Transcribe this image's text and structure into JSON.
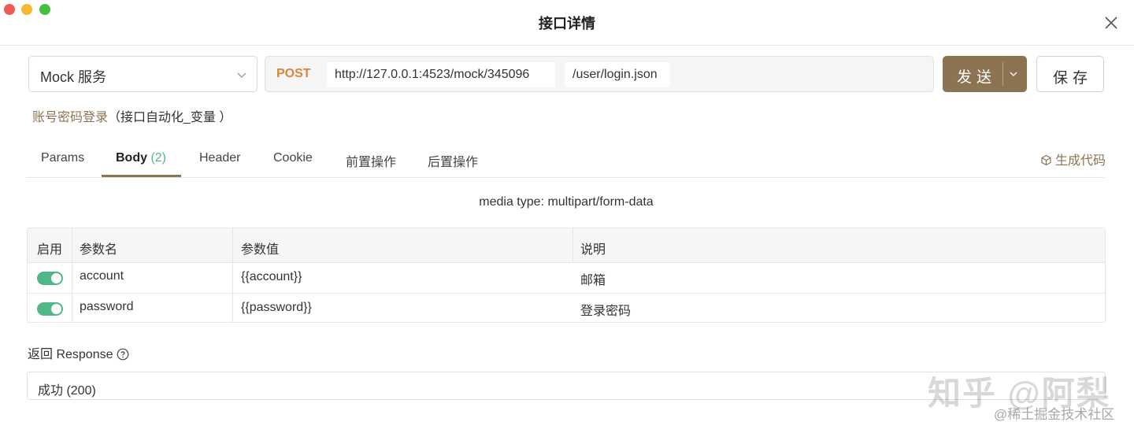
{
  "window": {
    "title": "接口详情"
  },
  "env": {
    "value": "Mock 服务"
  },
  "request": {
    "method": "POST",
    "base_url": "http://127.0.0.1:4523/mock/345096",
    "path": "/user/login.json"
  },
  "actions": {
    "send_label": "发送",
    "save_label": "保存"
  },
  "api": {
    "name": "账号密码登录",
    "group": "（接口自动化_变量 ）"
  },
  "tabs": [
    {
      "label": "Params"
    },
    {
      "label": "Body",
      "count": "(2)"
    },
    {
      "label": "Header"
    },
    {
      "label": "Cookie"
    },
    {
      "label": "前置操作"
    },
    {
      "label": "后置操作"
    }
  ],
  "gen_code_label": "生成代码",
  "media_type": "media type: multipart/form-data",
  "table": {
    "headers": [
      "启用",
      "参数名",
      "参数值",
      "说明"
    ],
    "rows": [
      {
        "enabled": true,
        "name": "account",
        "value": "{{account}}",
        "desc": "邮箱"
      },
      {
        "enabled": true,
        "name": "password",
        "value": "{{password}}",
        "desc": "登录密码"
      }
    ]
  },
  "response": {
    "label": "返回 Response",
    "value": "成功 (200)"
  },
  "watermarks": {
    "zhihu": "知乎 @阿梨",
    "juejin": "@稀土掘金技术社区"
  },
  "colors": {
    "accent": "#8c7352",
    "method": "#d9853b",
    "toggle": "#52b788"
  }
}
